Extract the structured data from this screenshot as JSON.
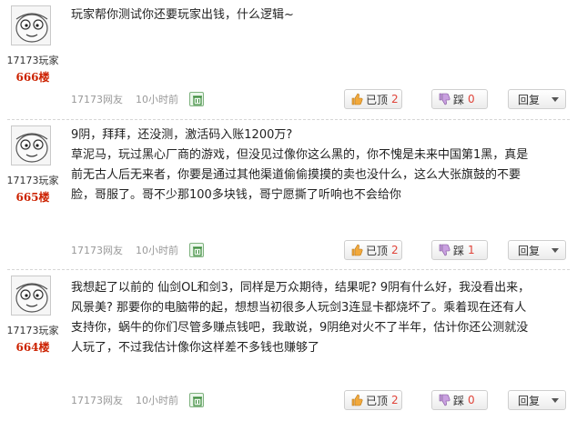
{
  "comments": [
    {
      "username": "17173玩家",
      "floor": "666楼",
      "lines": [
        "玩家帮你测试你还要玩家出钱，什么逻辑~"
      ],
      "source": "17173网友",
      "time": "10小时前",
      "up_label": "已顶",
      "up_count": "2",
      "down_label": "踩",
      "down_count": "0",
      "reply_label": "回复"
    },
    {
      "username": "17173玩家",
      "floor": "665楼",
      "lines": [
        "9阴，拜拜，还没测，激活码入账1200万?",
        "草泥马，玩过黑心厂商的游戏，但没见过像你这么黑的，你不愧是未来中国第1黑，真是",
        "前无古人后无来者，你要是通过其他渠道偷偷摸摸的卖也没什么，这么大张旗鼓的不要",
        "脸，哥服了。哥不少那100多块钱，哥宁愿撕了听响也不会给你"
      ],
      "source": "17173网友",
      "time": "10小时前",
      "up_label": "已顶",
      "up_count": "2",
      "down_label": "踩",
      "down_count": "1",
      "reply_label": "回复"
    },
    {
      "username": "17173玩家",
      "floor": "664楼",
      "lines": [
        "我想起了以前的 仙剑OL和剑3，同样是万众期待，结果呢? 9阴有什么好，我没看出来，",
        "风景美? 那要你的电脑带的起，想想当初很多人玩剑3连显卡都烧坏了。乘着现在还有人",
        "支持你，蜗牛的你们尽管多赚点钱吧，我敢说，9阴绝对火不了半年，估计你还公测就没",
        "人玩了，不过我估计像你这样差不多钱也赚够了"
      ],
      "source": "17173网友",
      "time": "10小时前",
      "up_label": "已顶",
      "up_count": "2",
      "down_label": "踩",
      "down_count": "0",
      "reply_label": "回复"
    }
  ],
  "icons": {
    "avatar": "cartoon-face-avatar",
    "delete": "trash-icon",
    "up": "thumb-up-icon",
    "down": "thumb-down-icon",
    "reply_caret": "chevron-down-icon"
  },
  "colors": {
    "floor": "#cc2200",
    "count": "#e0443a",
    "meta": "#999999"
  }
}
